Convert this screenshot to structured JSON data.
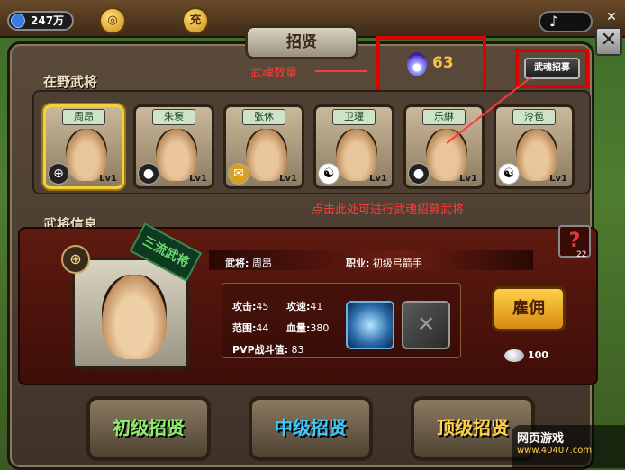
{
  "topbar": {
    "money": "247万",
    "coin_label": "充",
    "music_icon": "music-note-icon"
  },
  "panel": {
    "title": "招贤",
    "wild_generals_label": "在野武将",
    "general_info_label": "武将信息"
  },
  "soul": {
    "value": "63",
    "caption": "武魂数量",
    "recruit_button": "武魂招募",
    "hint": "点击此处可进行武魂招募武将"
  },
  "heroes": [
    {
      "name": "周昂",
      "level": "Lv1",
      "emblem": "crossbow-icon",
      "selected": true
    },
    {
      "name": "朱褒",
      "level": "Lv1",
      "emblem": "bomb-icon",
      "selected": false
    },
    {
      "name": "张休",
      "level": "Lv1",
      "emblem": "scroll-icon",
      "selected": false
    },
    {
      "name": "卫瓘",
      "level": "Lv1",
      "emblem": "yinyang-icon",
      "selected": false
    },
    {
      "name": "乐綝",
      "level": "Lv1",
      "emblem": "bomb-icon",
      "selected": false
    },
    {
      "name": "泠苞",
      "level": "Lv1",
      "emblem": "yinyang-icon",
      "selected": false
    }
  ],
  "info": {
    "rank_badge": "三流武将",
    "name_label": "武将:",
    "name_value": "周昂",
    "job_label": "职业:",
    "job_value": "初级弓箭手",
    "attack_label": "攻击:",
    "attack_value": "45",
    "speed_label": "攻速:",
    "speed_value": "41",
    "range_label": "范围:",
    "range_value": "44",
    "hp_label": "血量:",
    "hp_value": "380",
    "pvp_label": "PVP战斗值:",
    "pvp_value": "83",
    "hire_button": "雇佣",
    "silver_cost": "100",
    "help_count": "22"
  },
  "bottom": {
    "junior": "初级招贤",
    "mid": "中级招贤",
    "senior": "顶级招贤"
  },
  "watermark": {
    "title": "网页游戏",
    "url": "www.40407.com"
  }
}
